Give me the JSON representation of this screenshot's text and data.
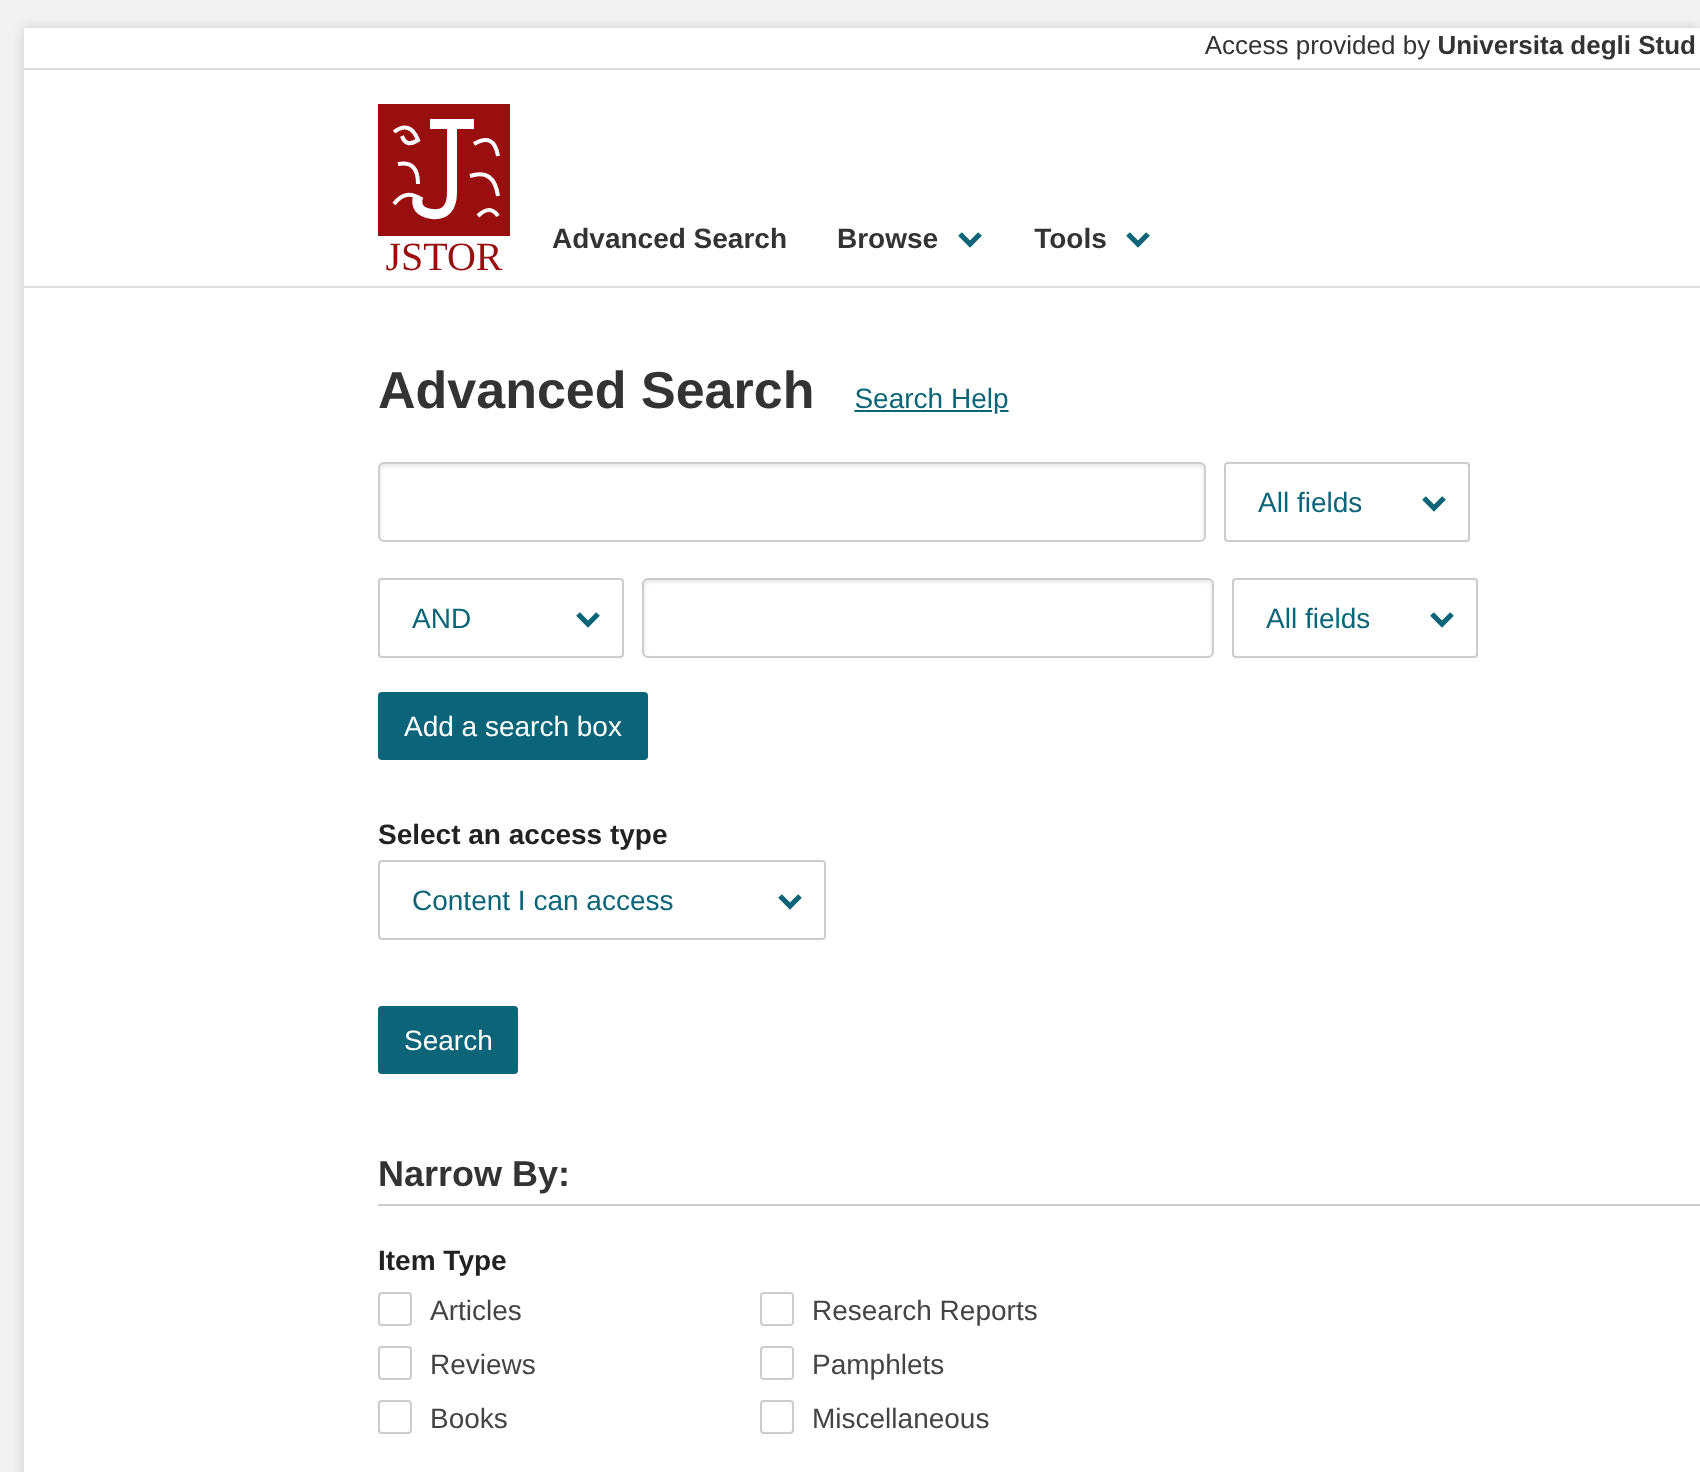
{
  "access_notice": "Access provided by **Universita degli Stud**",
  "nav": {
    "logo_text": "JSTOR",
    "items": [
      {
        "label": "Advanced Search",
        "has_menu": false
      },
      {
        "label": "Browse",
        "has_menu": true
      },
      {
        "label": "Tools",
        "has_menu": true
      }
    ]
  },
  "heading": "Advanced Search",
  "help_link": "Search Help",
  "search_rows": [
    {
      "operator": null,
      "field": "All fields"
    },
    {
      "operator": "AND",
      "field": "All fields"
    }
  ],
  "add_button": "Add a search box",
  "access_type": {
    "label": "Select an access type",
    "value": "Content I can access"
  },
  "search_button": "Search",
  "narrow_by": {
    "title": "Narrow By:",
    "group": "Item Type",
    "options": [
      {
        "label": "Articles",
        "checked": false
      },
      {
        "label": "Research Reports",
        "checked": false
      },
      {
        "label": "Reviews",
        "checked": false
      },
      {
        "label": "Pamphlets",
        "checked": false
      },
      {
        "label": "Books",
        "checked": false
      },
      {
        "label": "Miscellaneous",
        "checked": false
      }
    ]
  }
}
